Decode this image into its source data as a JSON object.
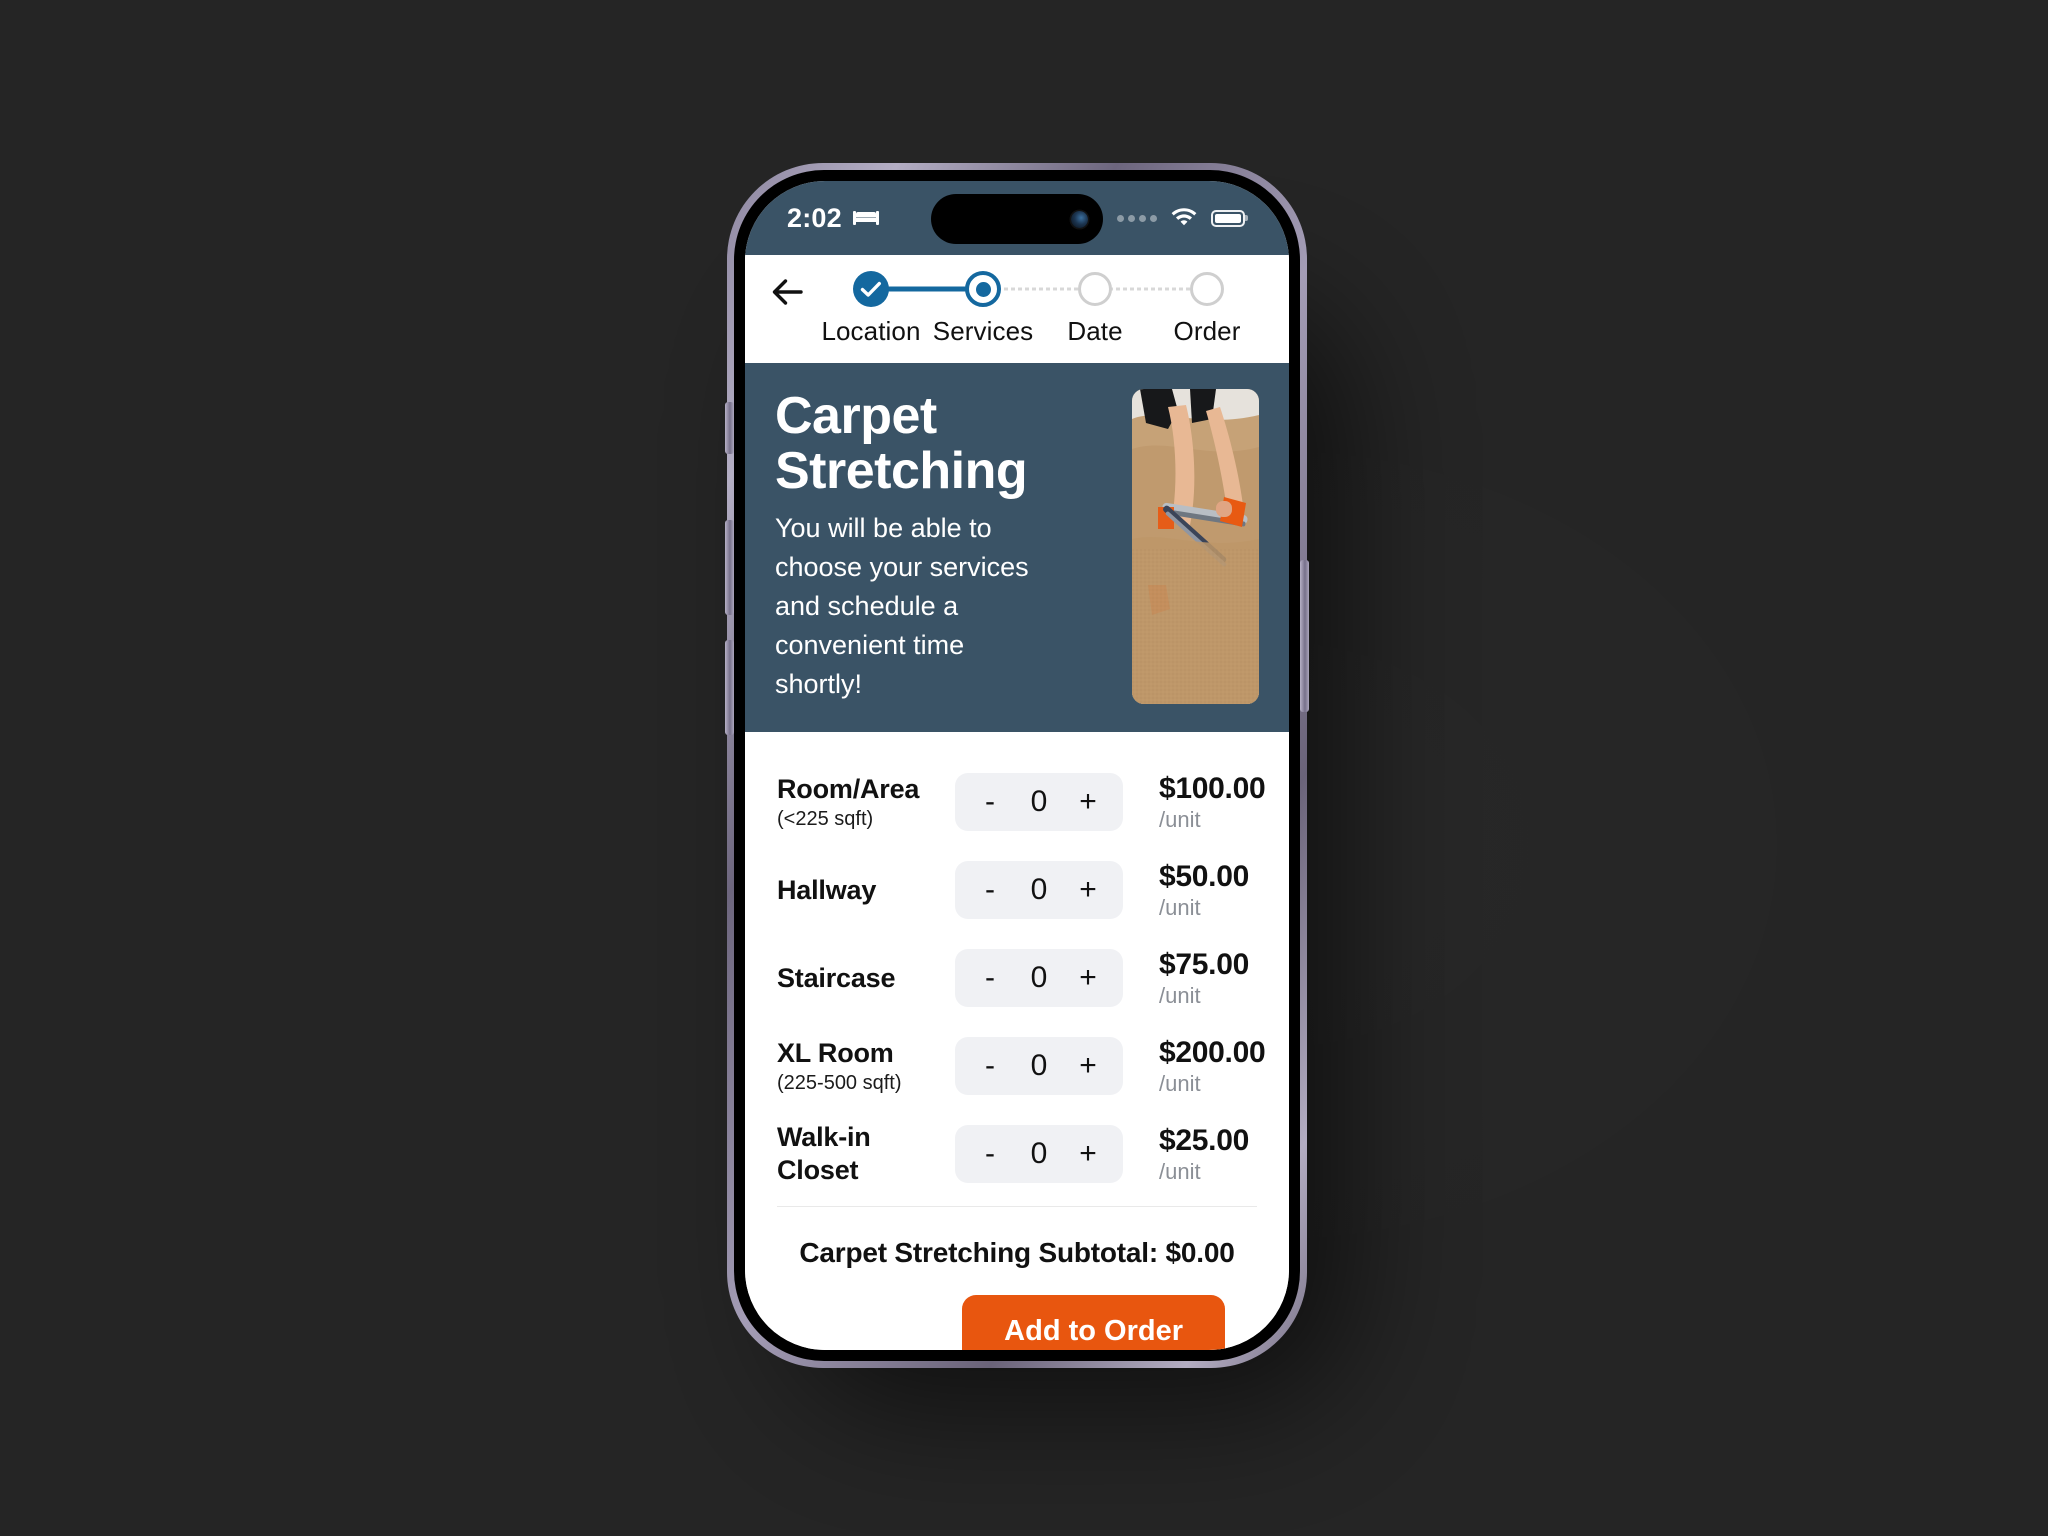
{
  "statusbar": {
    "time": "2:02",
    "bed_icon": "bed-icon",
    "signal_icon": "signal-dots-icon",
    "wifi_icon": "wifi-icon",
    "battery_icon": "battery-icon"
  },
  "nav": {
    "back_icon": "back-arrow-icon",
    "steps": [
      {
        "label": "Location",
        "state": "completed"
      },
      {
        "label": "Services",
        "state": "active"
      },
      {
        "label": "Date",
        "state": "todo"
      },
      {
        "label": "Order",
        "state": "todo"
      }
    ]
  },
  "hero": {
    "title": "Carpet Stretching",
    "description": "You will be able to choose your services and schedule a convenient time shortly!",
    "image_alt": "carpet-stretching-photo"
  },
  "services": {
    "rows": [
      {
        "name": "Room/Area",
        "sub": "(<225 sqft)",
        "minus": "-",
        "qty": "0",
        "plus": "+",
        "price": "$100.00",
        "unit": "/unit"
      },
      {
        "name": "Hallway",
        "sub": "",
        "minus": "-",
        "qty": "0",
        "plus": "+",
        "price": "$50.00",
        "unit": "/unit"
      },
      {
        "name": "Staircase",
        "sub": "",
        "minus": "-",
        "qty": "0",
        "plus": "+",
        "price": "$75.00",
        "unit": "/unit"
      },
      {
        "name": "XL Room",
        "sub": "(225-500 sqft)",
        "minus": "-",
        "qty": "0",
        "plus": "+",
        "price": "$200.00",
        "unit": "/unit"
      },
      {
        "name": "Walk-in Closet",
        "sub": "",
        "minus": "-",
        "qty": "0",
        "plus": "+",
        "price": "$25.00",
        "unit": "/unit"
      }
    ],
    "subtotal": "Carpet Stretching Subtotal: $0.00",
    "cta_label": "Add to Order"
  },
  "colors": {
    "hero_bg": "#3a5366",
    "accent_blue": "#14689f",
    "cta_orange": "#e8560f",
    "chip_gray": "#f0f1f4",
    "muted_text": "#8b8f96",
    "page_bg": "#252525"
  }
}
